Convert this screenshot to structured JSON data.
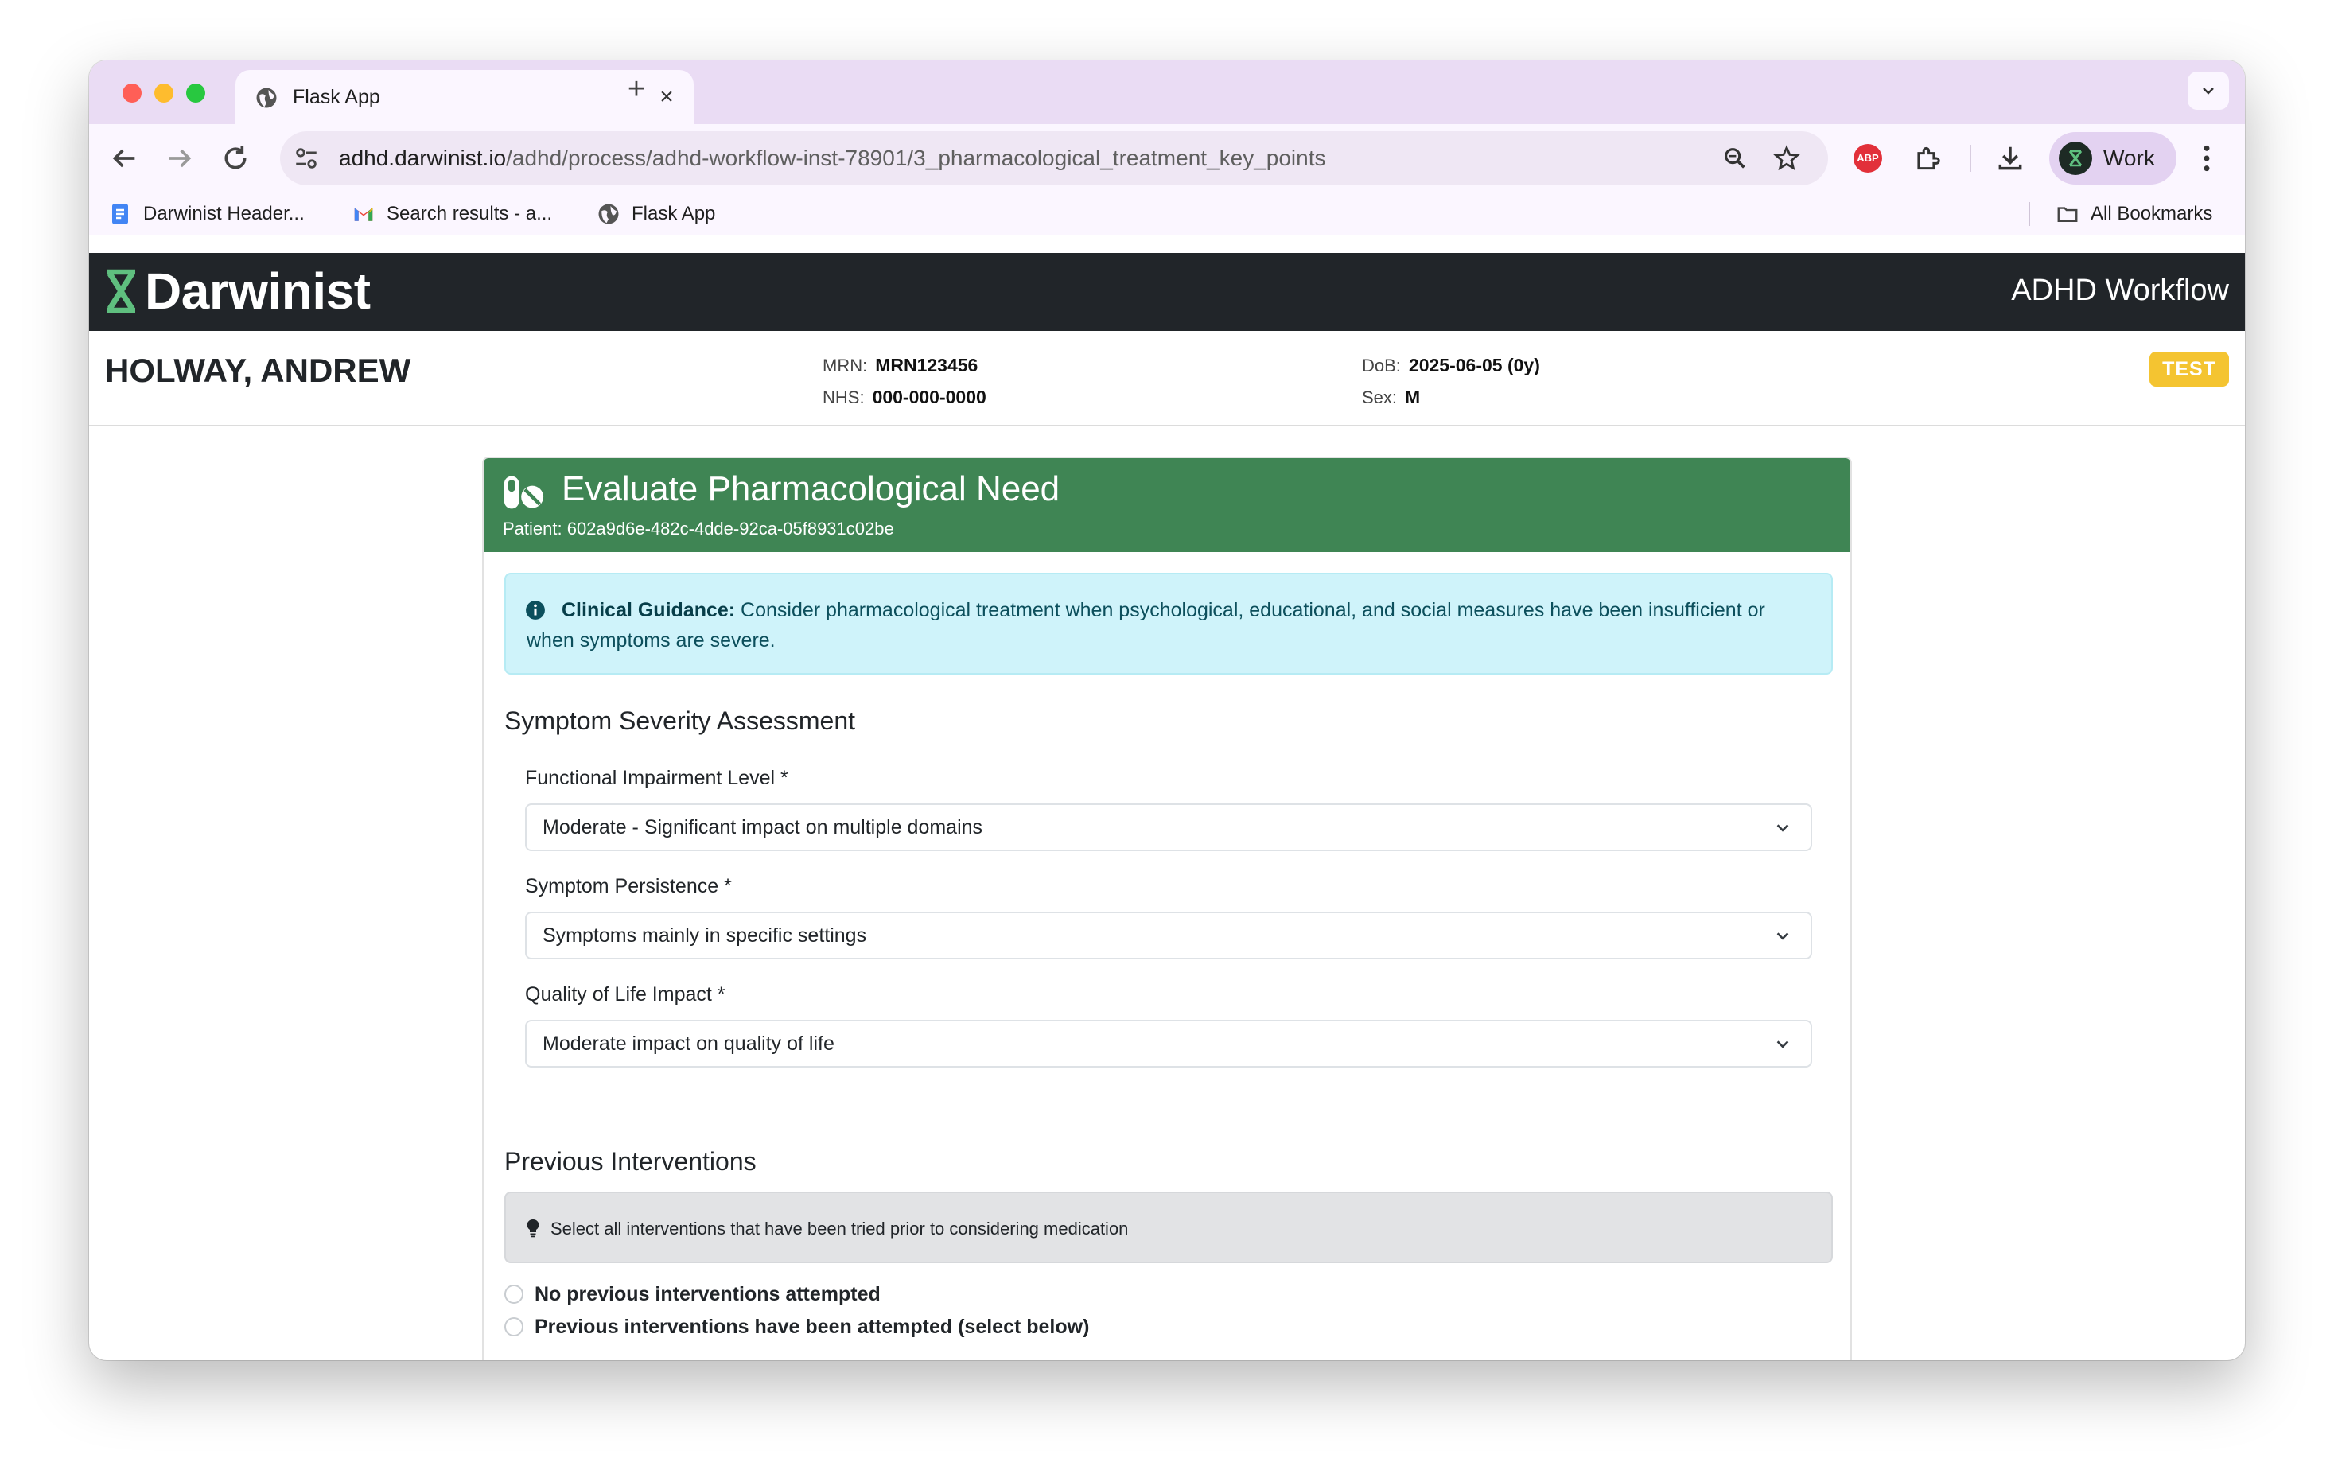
{
  "browser": {
    "tab_title": "Flask App",
    "url_host": "adhd.darwinist.io",
    "url_path": "/adhd/process/adhd-workflow-inst-78901/3_pharmacological_treatment_key_points",
    "profile_label": "Work",
    "abp_label": "ABP",
    "bookmarks": [
      {
        "label": "Darwinist Header...",
        "icon": "docs-icon"
      },
      {
        "label": "Search results - a...",
        "icon": "gmail-icon"
      },
      {
        "label": "Flask App",
        "icon": "globe-icon"
      }
    ],
    "all_bookmarks_label": "All Bookmarks"
  },
  "app": {
    "brand": "Darwinist",
    "workflow_title": "ADHD Workflow",
    "colors": {
      "appbar": "#212529",
      "brand_icon": "#5fbf7f",
      "header_green": "#3f8554",
      "test_badge": "#f4c431"
    }
  },
  "patient": {
    "name": "HOLWAY, ANDREW",
    "mrn_label": "MRN:",
    "mrn": "MRN123456",
    "nhs_label": "NHS:",
    "nhs": "000-000-0000",
    "dob_label": "DoB:",
    "dob": "2025-06-05 (0y)",
    "sex_label": "Sex:",
    "sex": "M",
    "badge": "TEST"
  },
  "card": {
    "title": "Evaluate Pharmacological Need",
    "patient_id": "Patient: 602a9d6e-482c-4dde-92ca-05f8931c02be",
    "guidance_label": "Clinical Guidance:",
    "guidance_text": " Consider pharmacological treatment when psychological, educational, and social measures have been insufficient or when symptoms are severe.",
    "severity_title": "Symptom Severity Assessment",
    "fields": [
      {
        "label": "Functional Impairment Level *",
        "value": "Moderate - Significant impact on multiple domains"
      },
      {
        "label": "Symptom Persistence *",
        "value": "Symptoms mainly in specific settings"
      },
      {
        "label": "Quality of Life Impact *",
        "value": "Moderate impact on quality of life"
      }
    ],
    "interventions_title": "Previous Interventions",
    "interventions_hint": "Select all interventions that have been tried prior to considering medication",
    "radio_options": [
      "No previous interventions attempted",
      "Previous interventions have been attempted (select below)"
    ]
  }
}
